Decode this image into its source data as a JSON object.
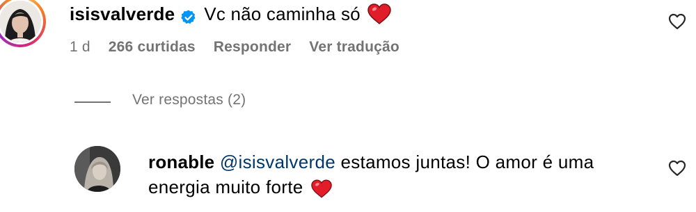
{
  "comment": {
    "username": "isisvalverde",
    "text": "Vc não caminha só",
    "meta": {
      "time": "1 d",
      "likes": "266 curtidas",
      "reply": "Responder",
      "translate": "Ver tradução"
    }
  },
  "replies_toggle": {
    "label": "Ver respostas (2)"
  },
  "reply": {
    "username": "ronable",
    "mention": "@isisvalverde",
    "text": "estamos juntas! O amor é uma energia muito forte"
  },
  "colors": {
    "text": "#000000",
    "secondary": "#737373",
    "mention": "#00376b",
    "verified": "#0095f6",
    "heart": "#ed4956"
  },
  "icons": {
    "verified": "verified-badge-icon",
    "heart": "red-heart-emoji",
    "like": "heart-outline-icon"
  }
}
